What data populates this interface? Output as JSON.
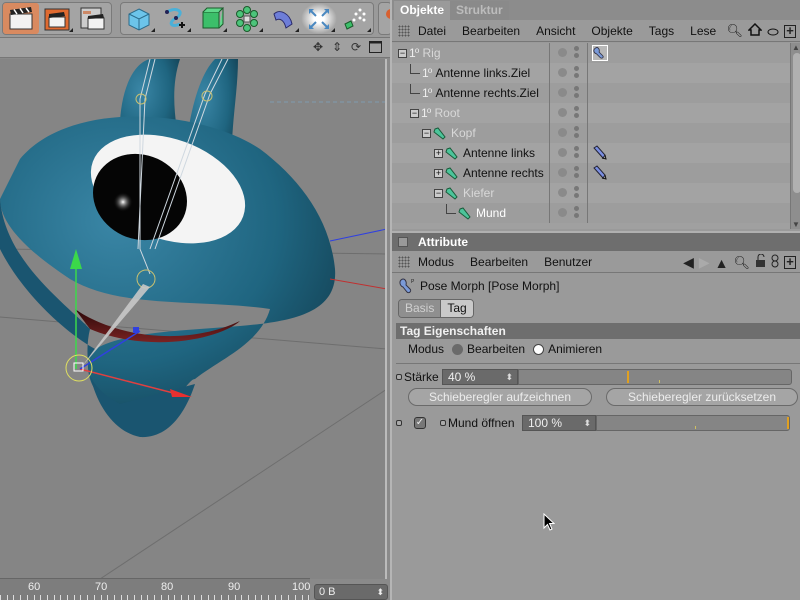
{
  "toolbar": {
    "groups": [
      {
        "name": "render",
        "buttons": [
          "render-view-icon",
          "render-picture-viewer-icon",
          "render-settings-icon"
        ]
      },
      {
        "name": "objects",
        "buttons": [
          "cube-icon",
          "spline-pen-icon",
          "nurbs-icon",
          "array-icon",
          "deformer-icon",
          "scene-icon",
          "particles-icon"
        ]
      }
    ]
  },
  "viewport": {
    "header_icons": [
      "move-view-icon",
      "zoom-view-icon",
      "rotate-view-icon",
      "maximize-view-icon"
    ],
    "colors": {
      "body": "#1f5f78",
      "eye_white": "#f4f4f4",
      "pupil": "#050505",
      "mouth": "#4a1414",
      "bg": "#858585"
    }
  },
  "timeline": {
    "labels": [
      "60",
      "70",
      "80",
      "90",
      "100"
    ],
    "memory_field": "0 B"
  },
  "object_manager": {
    "tabs": [
      {
        "label": "Objekte",
        "active": true
      },
      {
        "label": "Struktur",
        "active": false
      }
    ],
    "menu": [
      "Datei",
      "Bearbeiten",
      "Ansicht",
      "Objekte",
      "Tags",
      "Lese"
    ],
    "menu_icons": [
      "search-icon",
      "home-icon",
      "filter-icon",
      "new-panel-icon"
    ],
    "tree": [
      {
        "label": "Rig",
        "depth": 0,
        "type": "null",
        "expander": "minus",
        "style": "dim",
        "tag": "pose-morph-tag-icon",
        "tag_selected": true
      },
      {
        "label": "Antenne links.Ziel",
        "depth": 1,
        "type": "null",
        "expander": "",
        "style": "dark",
        "tag": ""
      },
      {
        "label": "Antenne rechts.Ziel",
        "depth": 1,
        "type": "null",
        "expander": "",
        "style": "dark",
        "tag": ""
      },
      {
        "label": "Root",
        "depth": 1,
        "type": "null",
        "expander": "minus",
        "style": "dim",
        "tag": ""
      },
      {
        "label": "Kopf",
        "depth": 2,
        "type": "joint",
        "expander": "minus",
        "style": "dim",
        "tag": ""
      },
      {
        "label": "Antenne links",
        "depth": 3,
        "type": "joint",
        "expander": "plus",
        "style": "dark",
        "tag": "ik-tag-icon"
      },
      {
        "label": "Antenne rechts",
        "depth": 3,
        "type": "joint",
        "expander": "plus",
        "style": "dark",
        "tag": "ik-tag-icon"
      },
      {
        "label": "Kiefer",
        "depth": 3,
        "type": "joint",
        "expander": "minus",
        "style": "dim",
        "tag": ""
      },
      {
        "label": "Mund",
        "depth": 4,
        "type": "joint",
        "expander": "",
        "style": "white",
        "tag": ""
      }
    ]
  },
  "attribute_manager": {
    "title": "Attribute",
    "menu": [
      "Modus",
      "Bearbeiten",
      "Benutzer"
    ],
    "menu_icons": [
      "back-arrow-icon",
      "forward-arrow-icon",
      "up-arrow-icon",
      "search-icon",
      "lock-icon",
      "link-icon",
      "new-panel-icon"
    ],
    "object_title": "Pose Morph [Pose Morph]",
    "tabs": [
      {
        "label": "Basis",
        "active": false
      },
      {
        "label": "Tag",
        "active": true
      }
    ],
    "section": "Tag Eigenschaften",
    "modus": {
      "label": "Modus",
      "options": [
        "Bearbeiten",
        "Animieren"
      ],
      "selected": "Animieren"
    },
    "staerke": {
      "label": "Stärke",
      "value": "40 %",
      "fraction": 0.4
    },
    "buttons": {
      "record": "Schieberegler aufzeichnen",
      "reset": "Schieberegler zurücksetzen"
    },
    "morphs": [
      {
        "label": "Mund öffnen",
        "value": "100 %",
        "fraction": 1.0,
        "enabled": true
      }
    ]
  },
  "colors": {
    "panel_bg": "#9a9a9a",
    "header_dark": "#6e6e6e",
    "slider_marker": "#e0a020",
    "active_tool": "#d98a60"
  }
}
